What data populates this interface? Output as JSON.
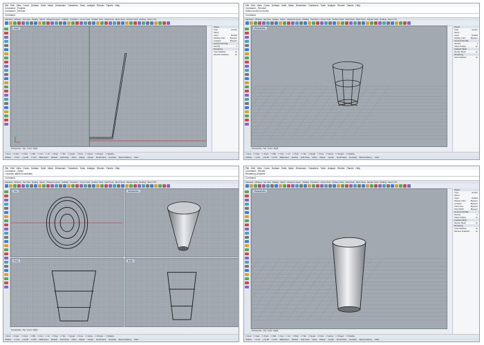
{
  "menu": [
    "File",
    "Edit",
    "View",
    "Curve",
    "Surface",
    "Solid",
    "Mesh",
    "Dimension",
    "Transform",
    "Tools",
    "Analyze",
    "Render",
    "Panels",
    "Help"
  ],
  "tabs": [
    "Standard",
    "CPlanes",
    "Set View",
    "Display",
    "Select",
    "Viewport Layout",
    "Visibility",
    "Transform",
    "Curve Tools",
    "Surface Tools",
    "Solid Tools",
    "Mesh Tools",
    "Render Tools",
    "Drafting",
    "New in V5"
  ],
  "viewport_tabs": [
    "Perspective",
    "Top",
    "Front",
    "Right"
  ],
  "snap_items": [
    "End",
    "Near",
    "Point",
    "Mid",
    "Cen",
    "Int",
    "Perp",
    "Tan",
    "Quad",
    "Knot",
    "Vertex",
    "Project",
    "Disable"
  ],
  "status_items": [
    "CPlane",
    "x 4.43",
    "y 31.96",
    "z 0.00",
    "Millimeters",
    "Default",
    "Grid Snap",
    "Ortho",
    "Planar",
    "Osnap",
    "SmartTrack",
    "Gumball",
    "Record History",
    "Filter"
  ],
  "properties": {
    "sections": [
      "Object",
      "Isocurve Density",
      "Analysis Mesh",
      "Rendering"
    ],
    "rows": [
      [
        "Type",
        "revolve"
      ],
      [
        "Name",
        ""
      ],
      [
        "Layer",
        "Default"
      ],
      [
        "Display Color",
        "ByLayer"
      ],
      [
        "Linetype",
        "ByLayer"
      ],
      [
        "Print Color",
        "ByLayer"
      ],
      [
        "Print Width",
        "ByLayer"
      ],
      [
        "Hyperlink",
        ""
      ],
      [
        "Density",
        "1"
      ],
      [
        "Show surface",
        "on"
      ],
      [
        "Render Mesh",
        "on"
      ],
      [
        "Cast shadows",
        "on"
      ],
      [
        "Receive shadows",
        "on"
      ]
    ]
  },
  "screens": [
    {
      "cmd_history": [
        "Command: _Polyline",
        "Command: _Revolve",
        "Command:"
      ],
      "command_prompt": "Command",
      "viewports": [
        {
          "label": "Front"
        }
      ]
    },
    {
      "cmd_history": [
        "Command: _Revolve",
        "Select curves to revolve",
        "Command:"
      ],
      "command_prompt": "Command",
      "viewports": [
        {
          "label": "Perspective"
        }
      ]
    },
    {
      "cmd_history": [
        "Command: _SelAll",
        "1 surface added to selection",
        "Command:"
      ],
      "command_prompt": "Command",
      "viewports": [
        {
          "label": "Top"
        },
        {
          "label": "Perspective"
        },
        {
          "label": "Front"
        },
        {
          "label": "Right"
        }
      ]
    },
    {
      "cmd_history": [
        "Command: _Render",
        "Rendering complete",
        "Command:"
      ],
      "command_prompt": "Command",
      "viewports": [
        {
          "label": "Perspective"
        }
      ]
    }
  ]
}
